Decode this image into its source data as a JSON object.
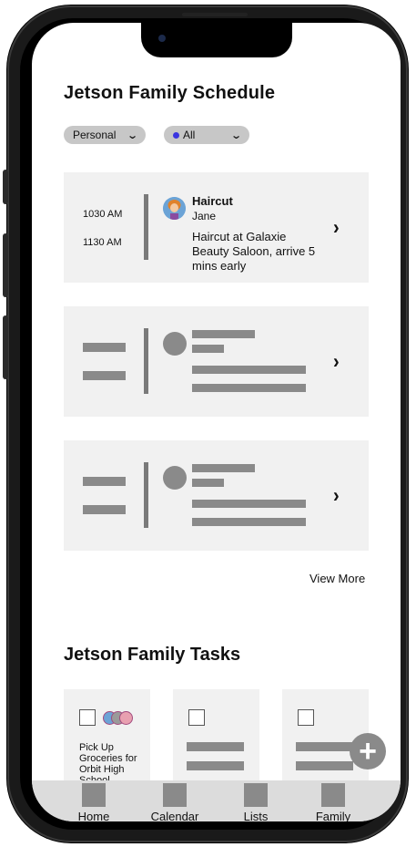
{
  "schedule": {
    "title": "Jetson Family Schedule",
    "filters": [
      {
        "label": "Personal"
      },
      {
        "label": "All",
        "dot_color": "#3b35e0"
      }
    ],
    "events": [
      {
        "start_time": "1030 AM",
        "end_time": "1130 AM",
        "title": "Haircut",
        "person": "Jane",
        "description": "Haircut at Galaxie Beauty Saloon, arrive 5 mins early"
      }
    ],
    "view_more_label": "View More"
  },
  "tasks": {
    "title": "Jetson Family Tasks",
    "items": [
      {
        "text": "Pick Up Groceries for Orbit High School"
      }
    ]
  },
  "nav": {
    "items": [
      {
        "label": "Home"
      },
      {
        "label": "Calendar"
      },
      {
        "label": "Lists"
      },
      {
        "label": "Family"
      }
    ]
  },
  "icons": {
    "chevron_down": "chevron-down-icon",
    "chevron_right": "chevron-right-icon",
    "add": "plus-icon"
  }
}
